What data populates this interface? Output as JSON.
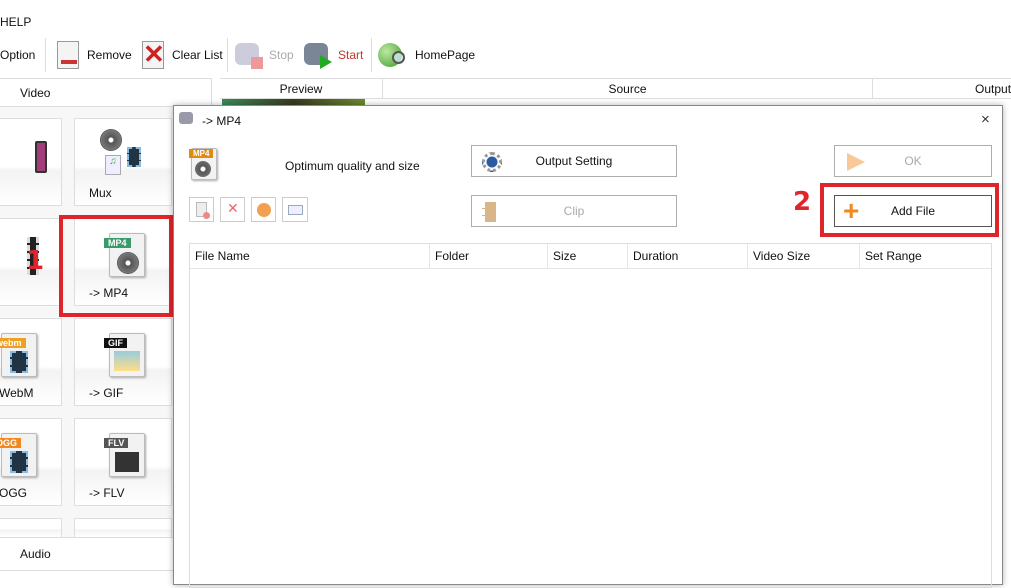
{
  "menu": {
    "help": "HELP"
  },
  "toolbar": {
    "option": "Option",
    "remove": "Remove",
    "clear_list": "Clear List",
    "stop": "Stop",
    "start": "Start",
    "homepage": "HomePage"
  },
  "left_panel": {
    "video_header": "Video",
    "audio_header": "Audio",
    "tiles": [
      {
        "label": "Mux"
      },
      {
        "label": "-> MP4"
      },
      {
        "label": "WebM"
      },
      {
        "label": "-> GIF"
      },
      {
        "label": "OGG"
      },
      {
        "label": "-> FLV"
      }
    ]
  },
  "list_header": {
    "columns": [
      "Preview",
      "Source",
      "Output"
    ]
  },
  "annotations": {
    "step1": "1",
    "step2": "2",
    "accent": "#e0242b"
  },
  "dialog": {
    "title": "-> MP4",
    "close": "×",
    "description": "Optimum quality and size",
    "output_setting": "Output Setting",
    "clip": "Clip",
    "ok": "OK",
    "add_file": "Add File",
    "format_tag": "MP4",
    "table": {
      "columns": [
        "File Name",
        "Folder",
        "Size",
        "Duration",
        "Video Size",
        "Set Range"
      ],
      "rows": []
    }
  }
}
